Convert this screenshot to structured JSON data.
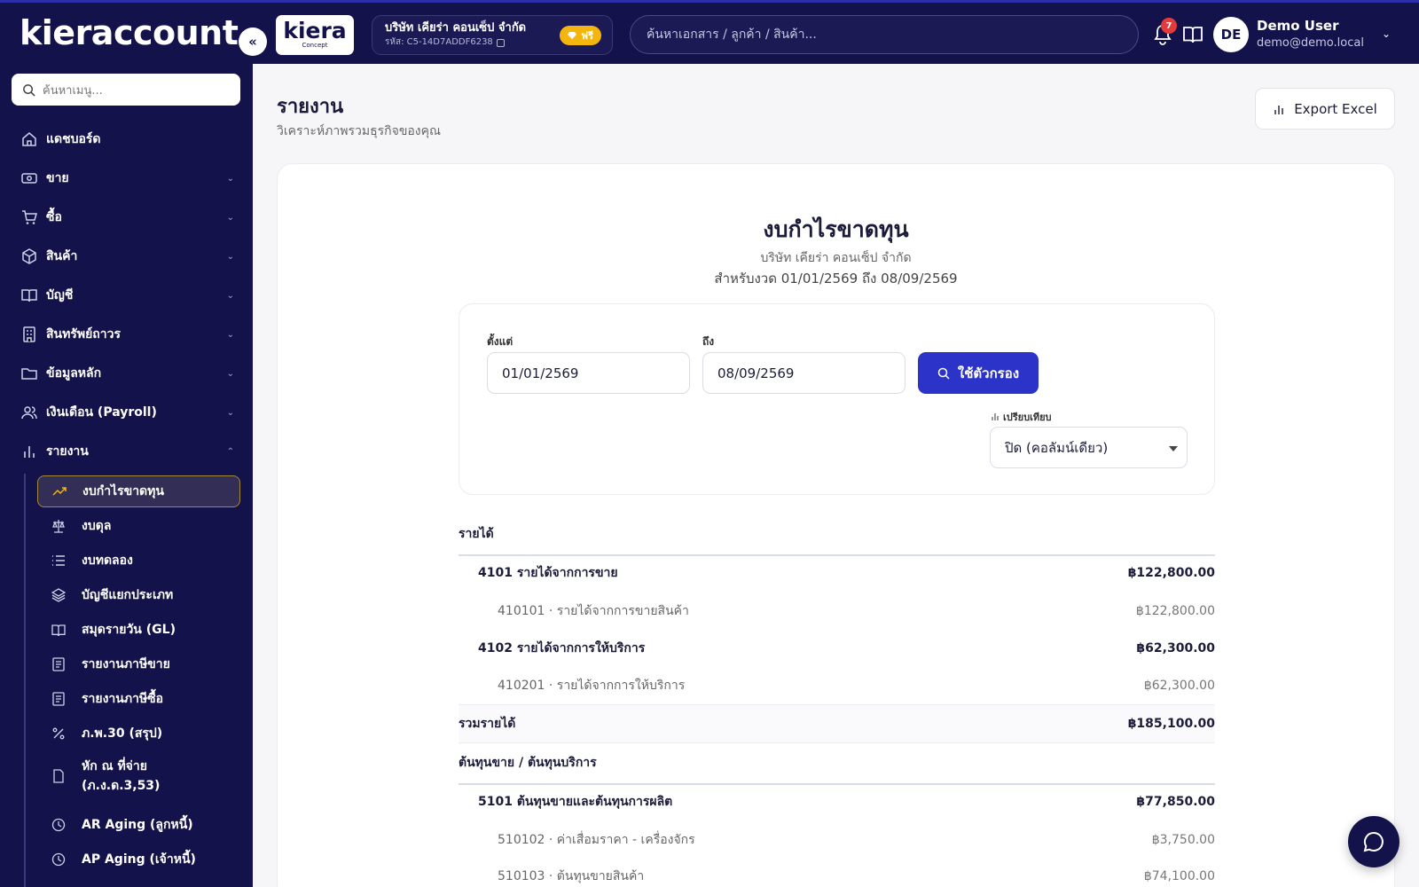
{
  "header": {
    "brand": "kieraccount",
    "collapse_label": "«",
    "logo_word": "kiera",
    "logo_sub": "Concept",
    "company_name": "บริษัท เคียร่า คอนเซ็ป จำกัด",
    "company_code": "รหัส: C5-14D7ADDF6238",
    "plan_badge": "ฟรี",
    "search_placeholder": "ค้นหาเอกสาร / ลูกค้า / สินค้า...",
    "notification_count": "7",
    "avatar_initials": "DE",
    "user_name": "Demo User",
    "user_email": "demo@demo.local"
  },
  "sidebar": {
    "search_placeholder": "ค้นหาเมนู...",
    "items": [
      {
        "label": "แดชบอร์ด",
        "icon": "home-icon"
      },
      {
        "label": "ขาย",
        "icon": "cash-icon"
      },
      {
        "label": "ซื้อ",
        "icon": "cart-icon"
      },
      {
        "label": "สินค้า",
        "icon": "box-icon"
      },
      {
        "label": "บัญชี",
        "icon": "book-icon"
      },
      {
        "label": "สินทรัพย์ถาวร",
        "icon": "building-icon"
      },
      {
        "label": "ข้อมูลหลัก",
        "icon": "folder-icon"
      },
      {
        "label": "เงินเดือน (Payroll)",
        "icon": "users-icon"
      },
      {
        "label": "รายงาน",
        "icon": "chart-icon"
      }
    ],
    "report_items": [
      {
        "label": "งบกำไรขาดทุน",
        "icon": "trend-icon"
      },
      {
        "label": "งบดุล",
        "icon": "scale-icon"
      },
      {
        "label": "งบทดลอง",
        "icon": "list-icon"
      },
      {
        "label": "บัญชีแยกประเภท",
        "icon": "layers-icon"
      },
      {
        "label": "สมุดรายวัน (GL)",
        "icon": "book-icon"
      },
      {
        "label": "รายงานภาษีขาย",
        "icon": "receipt-icon"
      },
      {
        "label": "รายงานภาษีซื้อ",
        "icon": "receipt-icon"
      },
      {
        "label": "ภ.พ.30 (สรุป)",
        "icon": "percent-icon"
      },
      {
        "label": "หัก ณ ที่จ่าย (ภ.ง.ด.3,53)",
        "icon": "file-icon"
      },
      {
        "label": "AR Aging (ลูกหนี้)",
        "icon": "clock-icon"
      },
      {
        "label": "AP Aging (เจ้าหนี้)",
        "icon": "clock-icon"
      }
    ]
  },
  "page": {
    "title": "รายงาน",
    "subtitle": "วิเคราะห์ภาพรวมธุรกิจของคุณ",
    "export_label": "Export Excel"
  },
  "report": {
    "title": "งบกำไรขาดทุน",
    "company": "บริษัท เคียร่า คอนเซ็ป จำกัด",
    "period": "สำหรับงวด 01/01/2569 ถึง 08/09/2569",
    "filter": {
      "from_label": "ตั้งแต่",
      "from_value": "01/01/2569",
      "to_label": "ถึง",
      "to_value": "08/09/2569",
      "apply_label": "ใช้ตัวกรอง",
      "compare_label": "เปรียบเทียบ",
      "compare_value": "ปิด (คอลัมน์เดียว)"
    },
    "revenue_section": "รายได้",
    "revenue_rows": [
      {
        "label": "4101 รายได้จากการขาย",
        "amount": "฿122,800.00",
        "kind": "group"
      },
      {
        "label": "410101 · รายได้จากการขายสินค้า",
        "amount": "฿122,800.00",
        "kind": "detail"
      },
      {
        "label": "4102 รายได้จากการให้บริการ",
        "amount": "฿62,300.00",
        "kind": "group"
      },
      {
        "label": "410201 · รายได้จากการให้บริการ",
        "amount": "฿62,300.00",
        "kind": "detail"
      }
    ],
    "revenue_total_label": "รวมรายได้",
    "revenue_total": "฿185,100.00",
    "cost_section": "ต้นทุนขาย / ต้นทุนบริการ",
    "cost_rows": [
      {
        "label": "5101 ต้นทุนขายและต้นทุนการผลิต",
        "amount": "฿77,850.00",
        "kind": "group"
      },
      {
        "label": "510102 · ค่าเสื่อมราคา - เครื่องจักร",
        "amount": "฿3,750.00",
        "kind": "detail"
      },
      {
        "label": "510103 · ต้นทุนขายสินค้า",
        "amount": "฿74,100.00",
        "kind": "detail"
      }
    ]
  }
}
